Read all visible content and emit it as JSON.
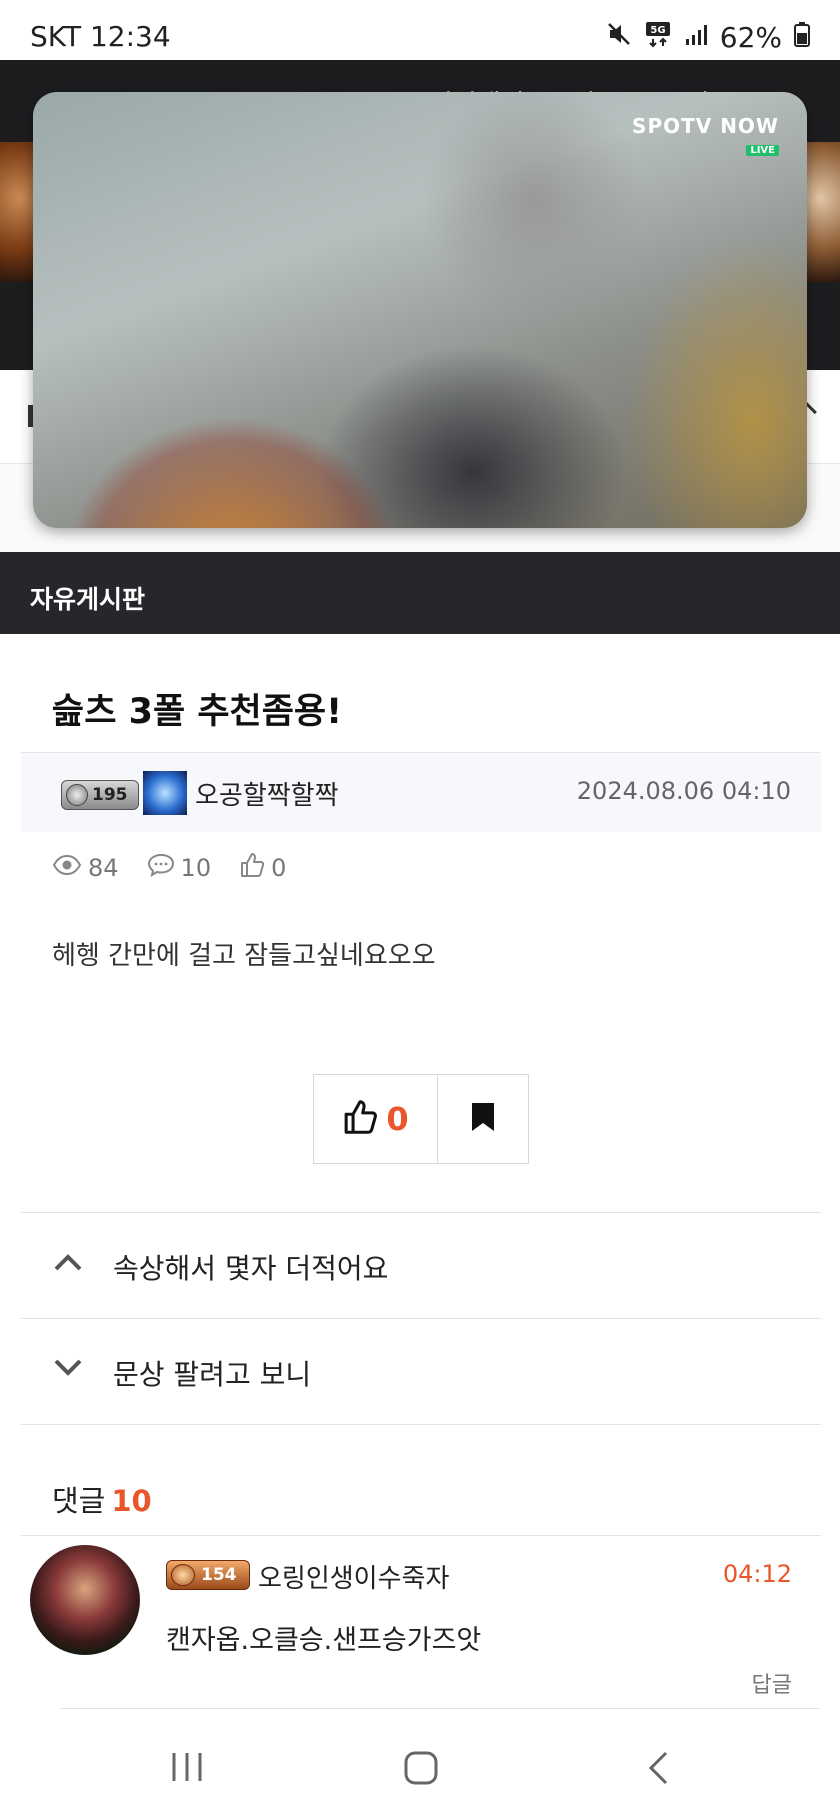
{
  "status_bar": {
    "carrier_time": "SKT 12:34",
    "network": "5G",
    "battery": "62%",
    "icons": [
      "mute-icon",
      "5g-icon",
      "signal-icon",
      "battery-icon"
    ]
  },
  "header": {
    "partial_title": "오링인생이수죽자 ... 주무셔요"
  },
  "video": {
    "logo_text": "SPOTV NOW",
    "logo_badge": "LIVE"
  },
  "board": {
    "title": "자유게시판"
  },
  "post": {
    "title": "슲츠 3폴 추천좀용!",
    "author_level": "195",
    "author": "오공할짝할짝",
    "date": "2024.08.06 04:10",
    "views": "84",
    "comments": "10",
    "likes": "0",
    "body": "헤헹 간만에 걸고 잠들고싶네요오오",
    "like_button_count": "0"
  },
  "navigation": {
    "prev_title": "속상해서 몇자 더적어요",
    "next_title": "문상 팔려고 보니"
  },
  "comments": {
    "label": "댓글",
    "count": "10",
    "items": [
      {
        "level": "154",
        "author": "오링인생이수죽자",
        "time": "04:12",
        "text": "캔자옵.오클승.샌프승가즈앗",
        "reply_label": "답글"
      }
    ]
  },
  "colors": {
    "accent": "#e8562a",
    "dark_bar": "#27272b",
    "header_bg": "#1d1d20"
  }
}
